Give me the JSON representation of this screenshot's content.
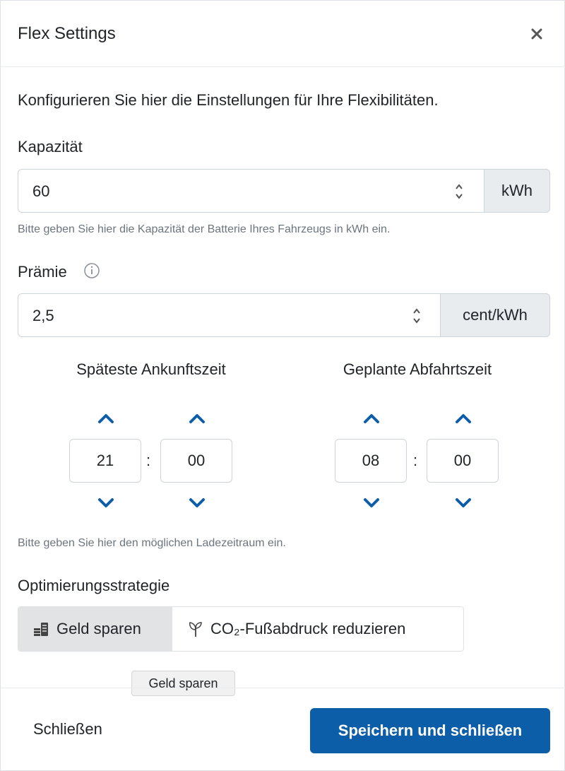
{
  "modal": {
    "title": "Flex Settings",
    "intro": "Konfigurieren Sie hier die Einstellungen für Ihre Flexibilitäten."
  },
  "capacity": {
    "label": "Kapazität",
    "value": "60",
    "unit": "kWh",
    "help": "Bitte geben Sie hier die Kapazität der Batterie Ihres Fahrzeugs in kWh ein."
  },
  "premium": {
    "label": "Prämie",
    "value": "2,5",
    "unit": "cent/kWh"
  },
  "arrival": {
    "title": "Späteste Ankunftszeit",
    "hours": "21",
    "minutes": "00"
  },
  "departure": {
    "title": "Geplante Abfahrtszeit",
    "hours": "08",
    "minutes": "00"
  },
  "time_separator": ":",
  "time_help": "Bitte geben Sie hier den möglichen Ladezeitraum ein.",
  "strategy": {
    "label": "Optimierungsstrategie",
    "options": [
      {
        "label": "Geld sparen",
        "icon": "money-icon",
        "active": true
      },
      {
        "label": "CO₂-Fußabdruck reduzieren",
        "icon": "plant-icon",
        "active": false
      }
    ],
    "tooltip": "Geld sparen"
  },
  "footer": {
    "close_label": "Schließen",
    "save_label": "Speichern und schließen"
  },
  "colors": {
    "primary": "#0d5ea8",
    "chevron": "#0d5ea8",
    "addon_bg": "#e9ecef",
    "active_segment": "#e2e3e5"
  }
}
